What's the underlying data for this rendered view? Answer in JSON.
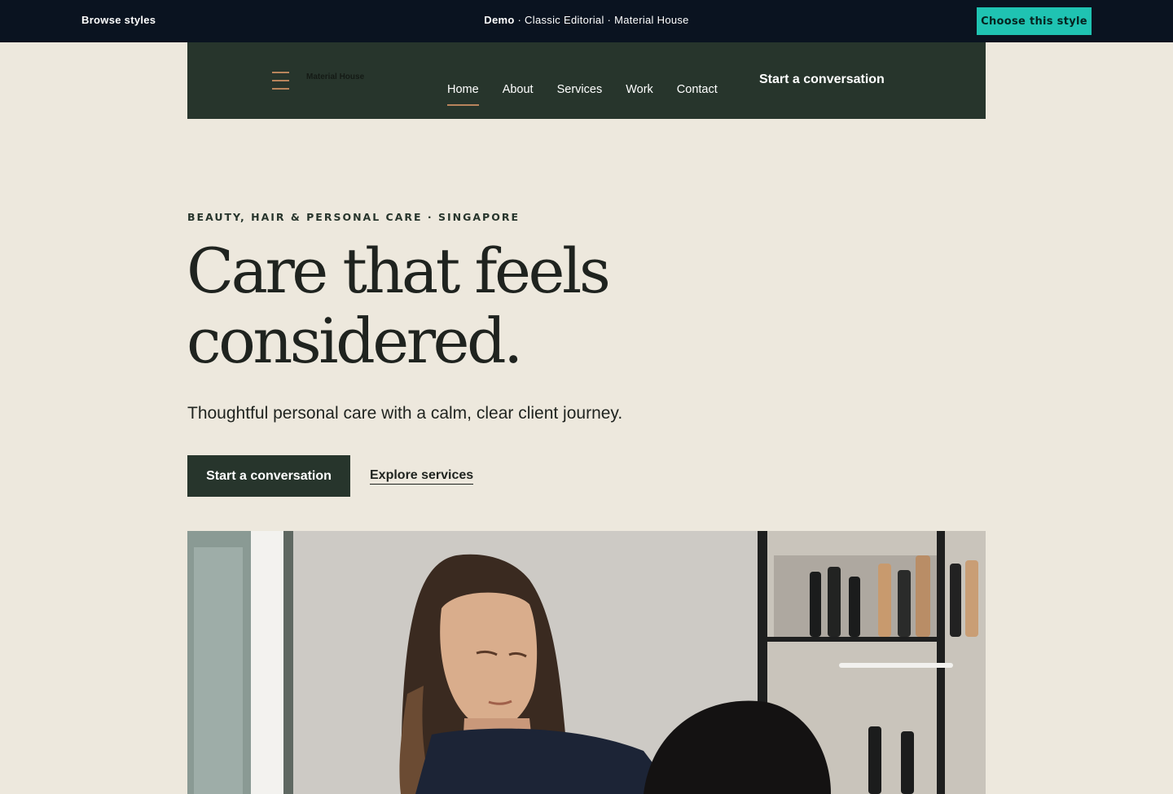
{
  "topbar": {
    "browse_label": "Browse styles",
    "demo_label": "Demo",
    "demo_suffix": " · Classic Editorial · Material House",
    "choose_label": "Choose this style"
  },
  "header": {
    "logo_text": "Material House",
    "nav": [
      {
        "label": "Home",
        "active": true
      },
      {
        "label": "About"
      },
      {
        "label": "Services"
      },
      {
        "label": "Work"
      },
      {
        "label": "Contact"
      }
    ],
    "cta_label": "Start a conversation"
  },
  "hero": {
    "eyebrow": "BEAUTY, HAIR & PERSONAL CARE · SINGAPORE",
    "headline_line1": "Care that feels",
    "headline_line2": "considered.",
    "subtitle": "Thoughtful personal care with a calm, clear client journey.",
    "primary_cta": "Start a conversation",
    "secondary_cta": "Explore services"
  },
  "colors": {
    "topbar_bg": "#0a1320",
    "accent_teal": "#1fc3b2",
    "header_green": "#27352c",
    "accent_copper": "#b8845c",
    "page_bg": "#ede8dd"
  },
  "icons": {
    "menu": "hamburger-menu-icon"
  }
}
